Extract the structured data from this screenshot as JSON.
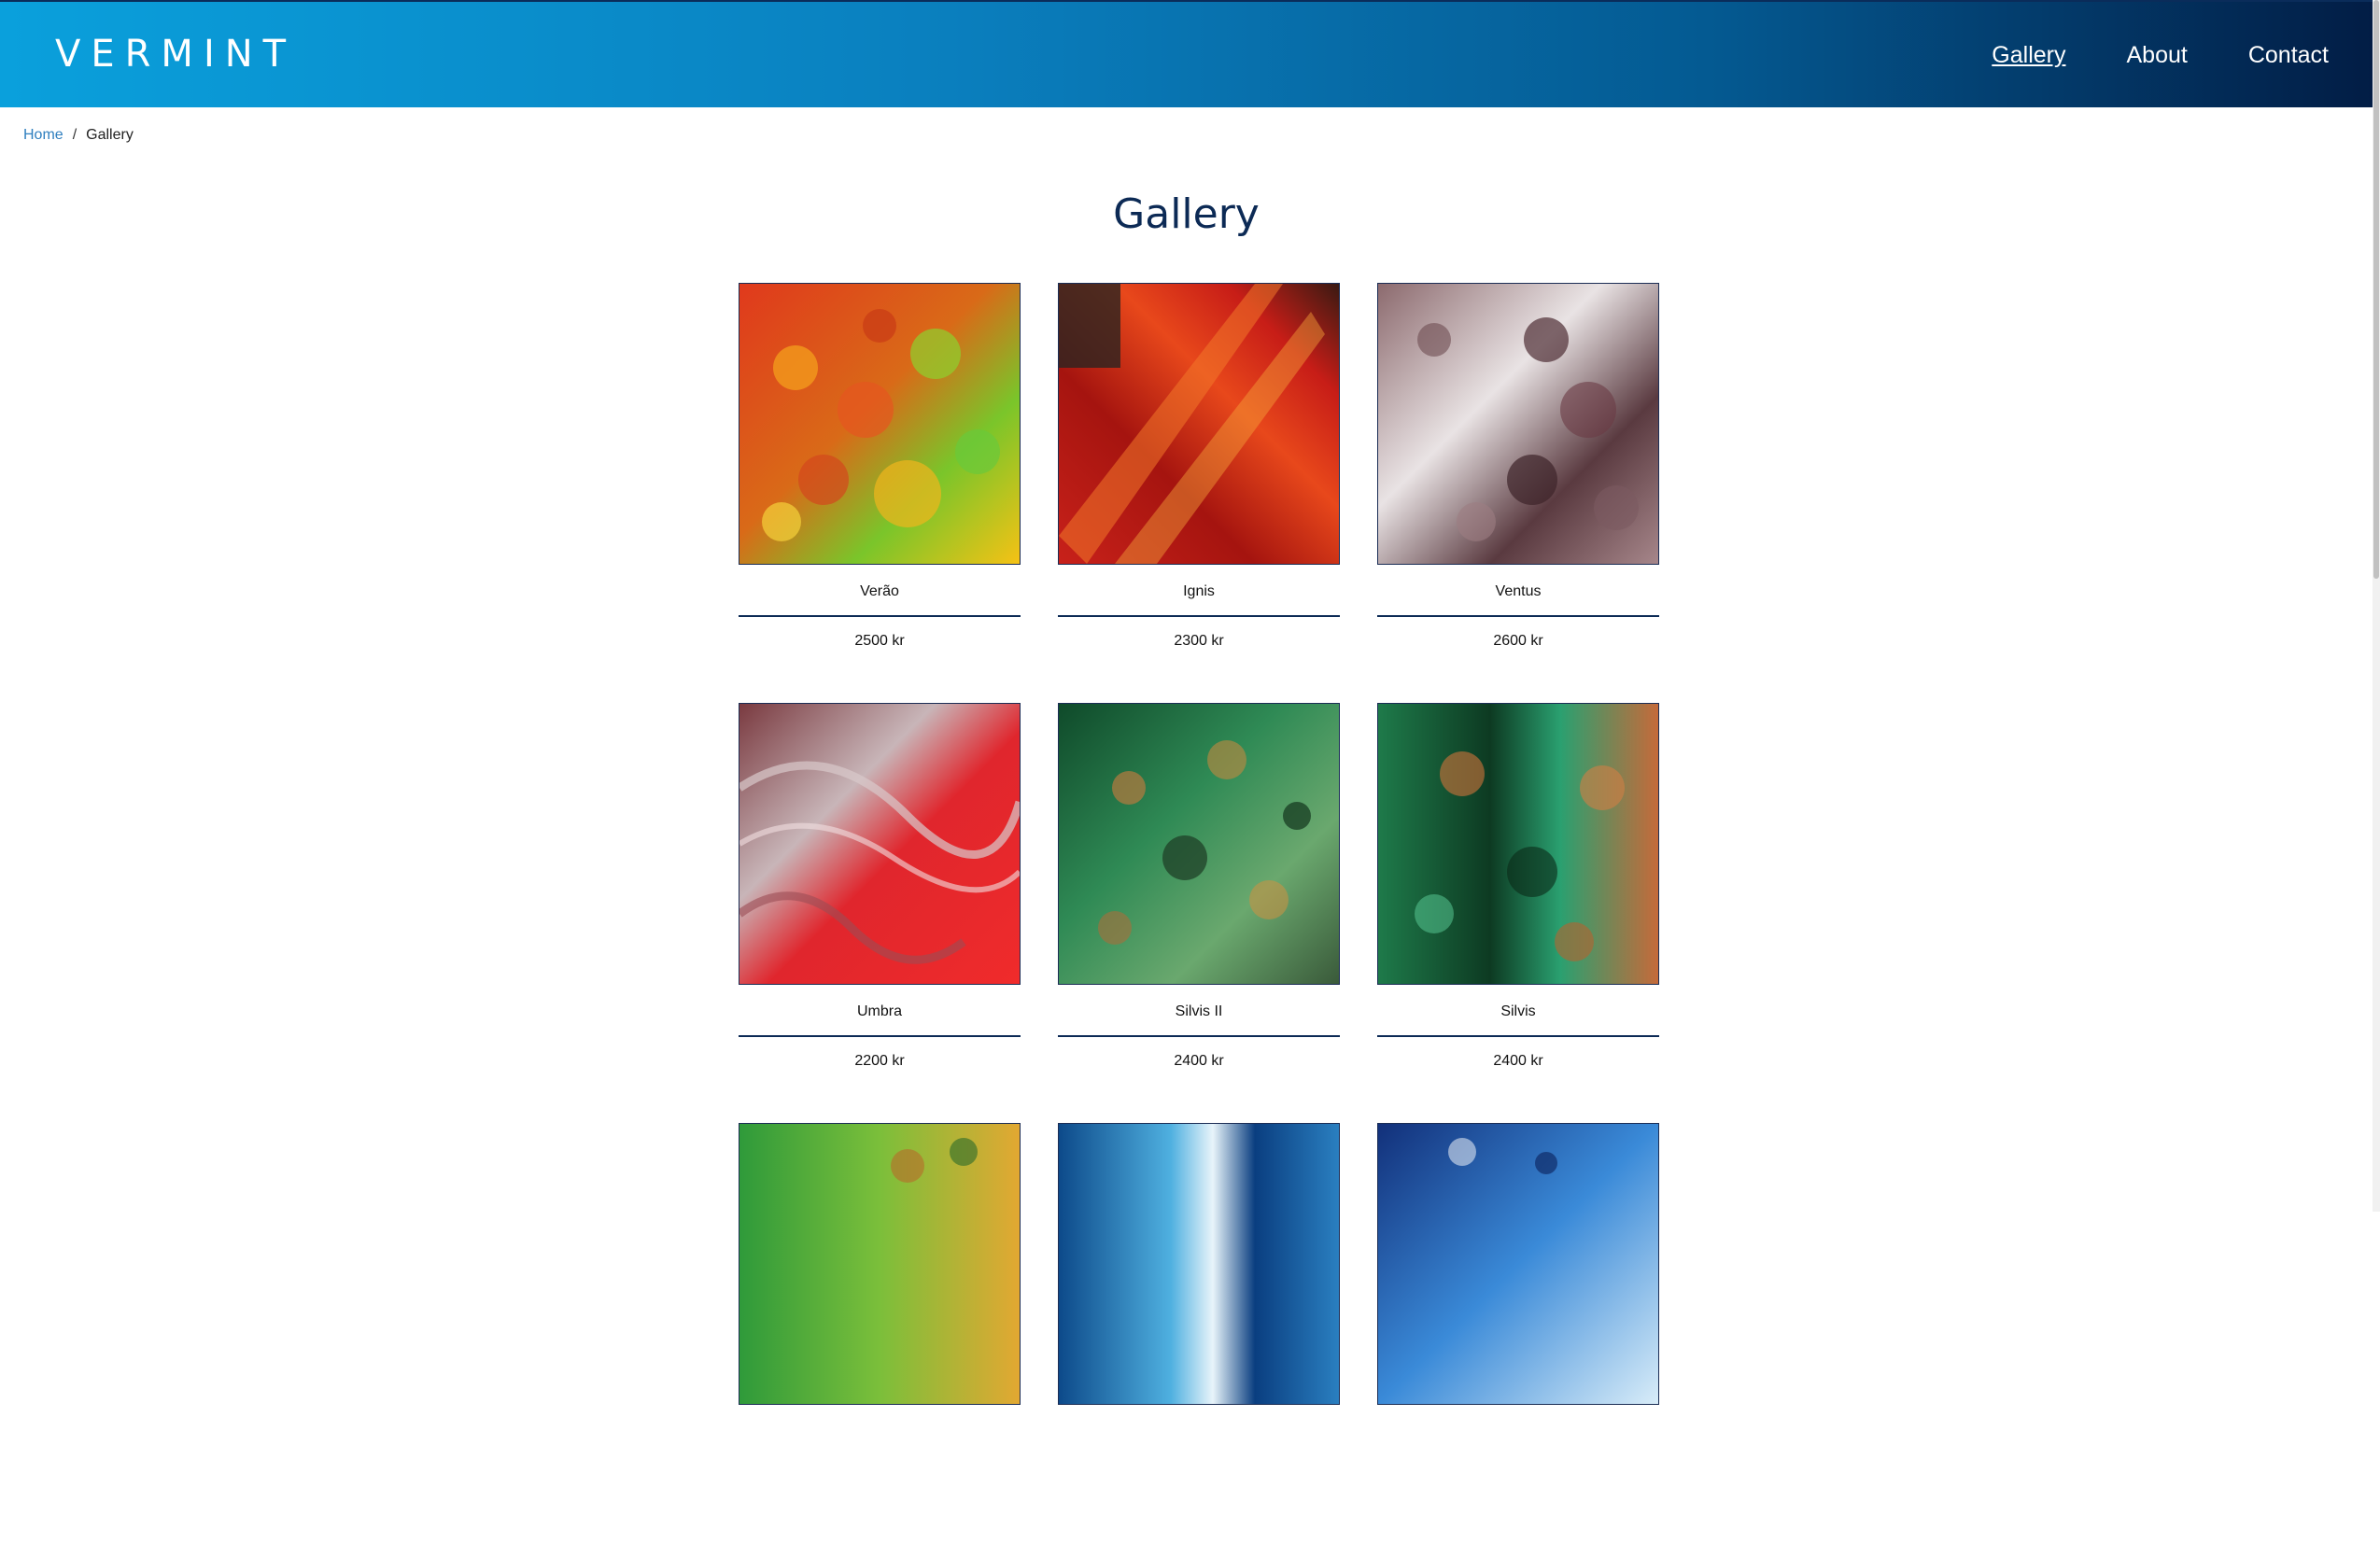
{
  "header": {
    "logo": "VERMINT",
    "nav": [
      {
        "label": "Gallery"
      },
      {
        "label": "About"
      },
      {
        "label": "Contact"
      }
    ]
  },
  "breadcrumb": {
    "home": "Home",
    "separator": "/",
    "current": "Gallery"
  },
  "page": {
    "title": "Gallery"
  },
  "gallery": [
    {
      "title": "Verão",
      "price": "2500 kr"
    },
    {
      "title": "Ignis",
      "price": "2300 kr"
    },
    {
      "title": "Ventus",
      "price": "2600 kr"
    },
    {
      "title": "Umbra",
      "price": "2200 kr"
    },
    {
      "title": "Silvis II",
      "price": "2400 kr"
    },
    {
      "title": "Silvis",
      "price": "2400 kr"
    },
    {
      "title": "",
      "price": ""
    },
    {
      "title": "",
      "price": ""
    },
    {
      "title": "",
      "price": ""
    }
  ],
  "colors": {
    "header_start": "#0aa0dc",
    "header_end": "#021d45",
    "title": "#0c2a55",
    "breadcrumb_link": "#2f7fbf"
  }
}
